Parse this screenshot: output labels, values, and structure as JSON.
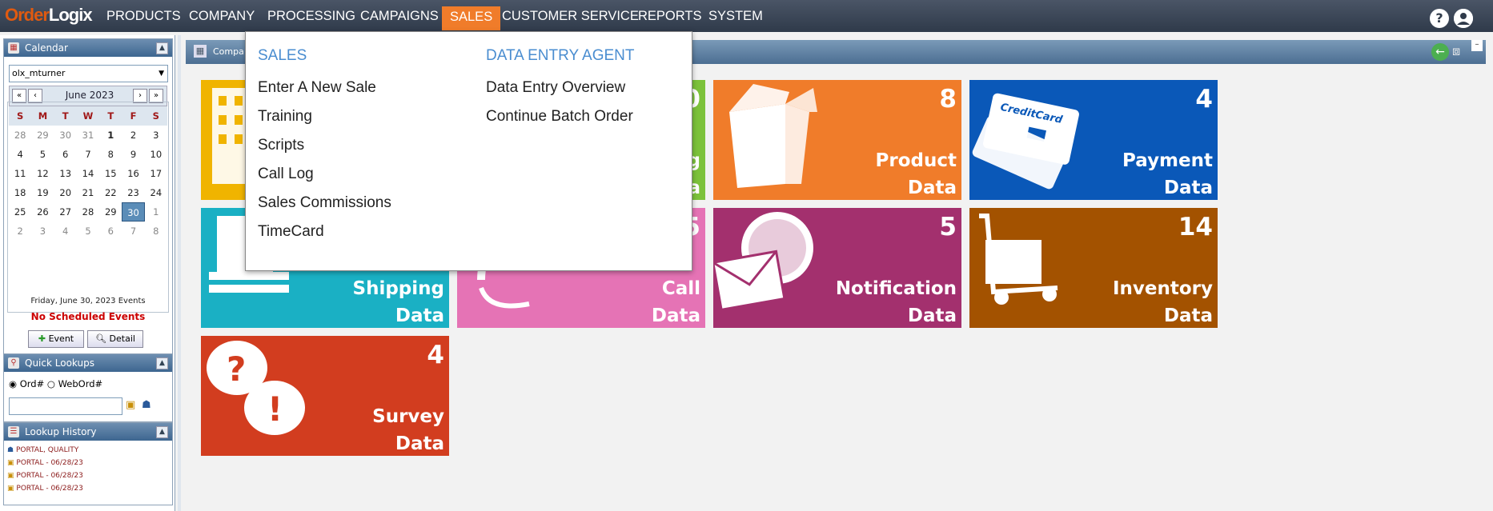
{
  "app": {
    "logo_part1": "Order",
    "logo_part2": "Logix"
  },
  "nav": {
    "items": [
      "PRODUCTS",
      "COMPANY",
      "PROCESSING",
      "CAMPAIGNS",
      "SALES",
      "CUSTOMER SERVICE",
      "REPORTS",
      "SYSTEM"
    ],
    "active": "SALES",
    "help_icon": "?",
    "user_icon": "user-icon"
  },
  "sidebar": {
    "calendar": {
      "title": "Calendar",
      "user_select": "olx_mturner",
      "month": "June 2023",
      "nav_prev2": "«",
      "nav_prev": "‹",
      "nav_next": "›",
      "nav_next2": "»",
      "dow": [
        "S",
        "M",
        "T",
        "W",
        "T",
        "F",
        "S"
      ],
      "weeks": [
        [
          "28",
          "29",
          "30",
          "31",
          "1",
          "2",
          "3"
        ],
        [
          "4",
          "5",
          "6",
          "7",
          "8",
          "9",
          "10"
        ],
        [
          "11",
          "12",
          "13",
          "14",
          "15",
          "16",
          "17"
        ],
        [
          "18",
          "19",
          "20",
          "21",
          "22",
          "23",
          "24"
        ],
        [
          "25",
          "26",
          "27",
          "28",
          "29",
          "30",
          "1"
        ],
        [
          "2",
          "3",
          "4",
          "5",
          "6",
          "7",
          "8"
        ]
      ],
      "selected_day": "30",
      "events_date": "Friday, June 30, 2023 Events",
      "events_none": "No Scheduled Events",
      "event_btn": "Event",
      "detail_btn": "Detail"
    },
    "quick_lookups": {
      "title": "Quick Lookups",
      "opt1": "Ord#",
      "opt2": "WebOrd#",
      "input_value": ""
    },
    "lookup_history": {
      "title": "Lookup History",
      "items": [
        "PORTAL, QUALITY",
        "PORTAL - 06/28/23",
        "PORTAL - 06/28/23",
        "PORTAL - 06/28/23"
      ]
    }
  },
  "content": {
    "header_title": "Compa",
    "tiles": [
      {
        "count": "8",
        "line1": "Product",
        "line2": "Data",
        "color": "#f07c2a"
      },
      {
        "count": "4",
        "line1": "Payment",
        "line2": "Data",
        "color": "#0a58b8"
      },
      {
        "count": "",
        "line1": "Shipping",
        "line2": "Data",
        "color": "#1ab0c4"
      },
      {
        "count": "5",
        "line1": "Call",
        "line2": "Data",
        "color": "#e573b5"
      },
      {
        "count": "5",
        "line1": "Notification",
        "line2": "Data",
        "color": "#a3306e"
      },
      {
        "count": "14",
        "line1": "Inventory",
        "line2": "Data",
        "color": "#a35200"
      },
      {
        "count": "4",
        "line1": "Survey",
        "line2": "Data",
        "color": "#d23d1f"
      },
      {
        "count": "0",
        "line1": "g",
        "line2": "a",
        "color": "#7cc23b"
      }
    ]
  },
  "dropdown": {
    "col1_head": "SALES",
    "col1_items": [
      "Enter A New Sale",
      "Training",
      "Scripts",
      "Call Log",
      "Sales Commissions",
      "TimeCard"
    ],
    "col2_head": "DATA ENTRY AGENT",
    "col2_items": [
      "Data Entry Overview",
      "Continue Batch Order"
    ]
  }
}
